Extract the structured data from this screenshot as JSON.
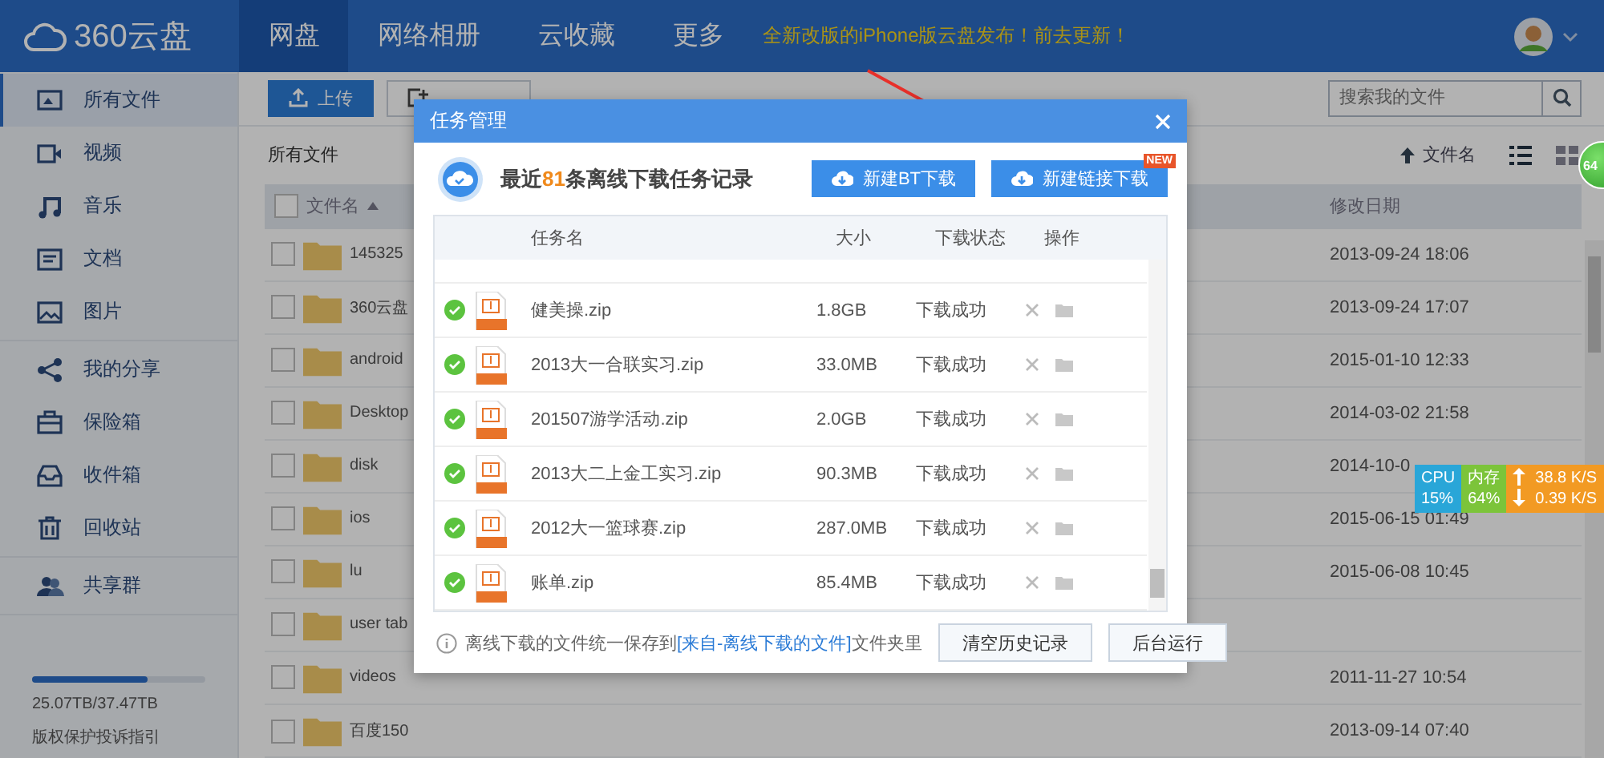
{
  "top_bar": {
    "logo": "360云盘",
    "nav": [
      {
        "label": "网盘",
        "selected": true
      },
      {
        "label": "网络相册",
        "selected": false
      },
      {
        "label": "云收藏",
        "selected": false
      },
      {
        "label": "更多",
        "selected": false
      }
    ],
    "notice": "全新改版的iPhone版云盘发布！前去更新！"
  },
  "sidebar": {
    "sections": [
      {
        "items": [
          {
            "label": "所有文件",
            "selected": true
          },
          {
            "label": "视频",
            "selected": false
          },
          {
            "label": "音乐",
            "selected": false
          },
          {
            "label": "文档",
            "selected": false
          },
          {
            "label": "图片",
            "selected": false
          }
        ]
      },
      {
        "items": [
          {
            "label": "我的分享",
            "selected": false
          },
          {
            "label": "保险箱",
            "selected": false
          },
          {
            "label": "收件箱",
            "selected": false
          },
          {
            "label": "回收站",
            "selected": false
          }
        ]
      },
      {
        "items": [
          {
            "label": "共享群",
            "selected": false
          }
        ]
      }
    ],
    "storage": {
      "level": 0.669,
      "reading": "25.07TB/37.47TB"
    },
    "footer_link": "版权保护投诉指引"
  },
  "toolbar": {
    "buttons": [
      "上传"
    ],
    "search": {
      "placeholder": "搜索我的文件"
    }
  },
  "breadcrumb": "所有文件",
  "sort": {
    "label": "文件名"
  },
  "table": {
    "columns": [
      "文件名",
      "修改日期"
    ],
    "header_checked": false,
    "rows": [
      {
        "name": "145325",
        "date": "2013-09-24 18:06",
        "checked": false
      },
      {
        "name": "360云盘",
        "date": "2013-09-24 17:07",
        "checked": false
      },
      {
        "name": "android",
        "date": "2015-01-10 12:33",
        "checked": false
      },
      {
        "name": "Desktop",
        "date": "2014-03-02 21:58",
        "checked": false
      },
      {
        "name": "disk",
        "date": "2014-10-0",
        "checked": false
      },
      {
        "name": "ios",
        "date": "2015-06-15 01:49",
        "checked": false
      },
      {
        "name": "lu",
        "date": "2015-06-08 10:45",
        "checked": false
      },
      {
        "name": "user tab",
        "date": "",
        "checked": false
      },
      {
        "name": "videos",
        "date": "2011-11-27 10:54",
        "checked": false
      },
      {
        "name": "百度150",
        "date": "2013-09-14 07:40",
        "checked": false
      }
    ]
  },
  "dialog": {
    "title": "任务管理",
    "headline": "最近**81**条离线下载任务记录",
    "buttons": [
      {
        "label": "新建BT下载"
      },
      {
        "label": "新建链接下载",
        "badge": "NEW"
      }
    ],
    "columns": [
      "任务名",
      "大小",
      "下载状态",
      "操作"
    ],
    "tasks": [
      {
        "name": "健美操.zip",
        "size": "1.8GB",
        "status": "下载成功"
      },
      {
        "name": "2013大一合联实习.zip",
        "size": "33.0MB",
        "status": "下载成功"
      },
      {
        "name": "201507游学活动.zip",
        "size": "2.0GB",
        "status": "下载成功"
      },
      {
        "name": "2013大二上金工实习.zip",
        "size": "90.3MB",
        "status": "下载成功"
      },
      {
        "name": "2012大一篮球赛.zip",
        "size": "287.0MB",
        "status": "下载成功"
      },
      {
        "name": "账单.zip",
        "size": "85.4MB",
        "status": "下载成功"
      }
    ],
    "note": {
      "before": "离线下载的文件统一保存到",
      "link": "[来自-离线下载的文件]",
      "after": "文件夹里"
    },
    "footer_buttons": [
      "清空历史记录",
      "后台运行"
    ]
  },
  "monitor": {
    "cpu": {
      "label": "CPU",
      "value": "15%"
    },
    "memory": {
      "label": "内存",
      "value": "64%"
    },
    "upload": "38.8 K/S",
    "download": "0.39 K/S"
  },
  "float_ball": "64"
}
